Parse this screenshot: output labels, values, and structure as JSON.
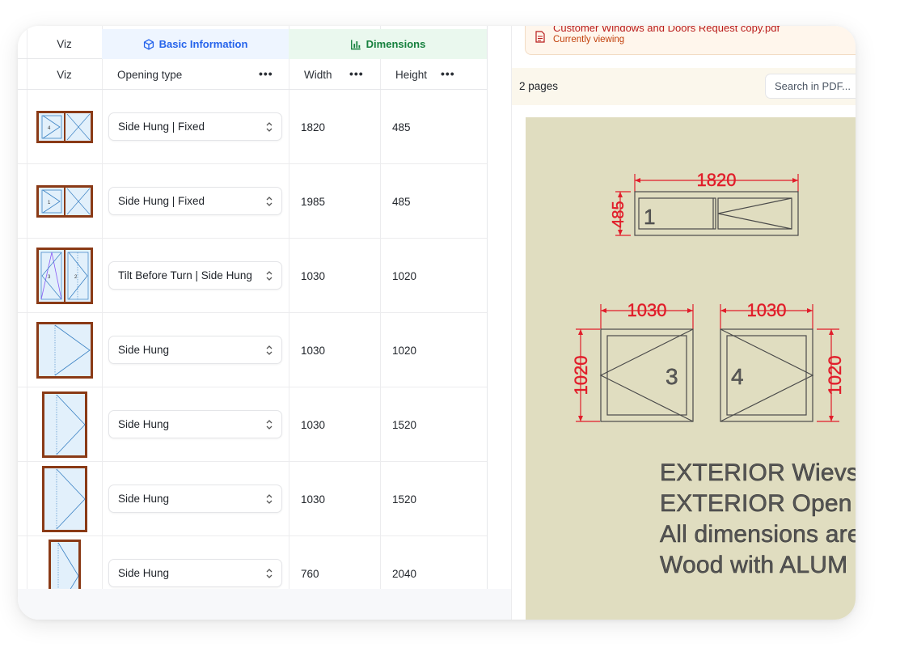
{
  "table": {
    "group_headers": {
      "viz": "Viz",
      "basic": "Basic Information",
      "dimensions": "Dimensions"
    },
    "column_headers": {
      "viz": "Viz",
      "opening_type": "Opening type",
      "width": "Width",
      "height": "Height"
    },
    "more_glyph": "•••",
    "rows": [
      {
        "opening_type": "Side Hung | Fixed",
        "width": "1820",
        "height": "485",
        "sash_labels": [
          "4"
        ]
      },
      {
        "opening_type": "Side Hung | Fixed",
        "width": "1985",
        "height": "485",
        "sash_labels": [
          "1"
        ]
      },
      {
        "opening_type": "Tilt Before Turn | Side Hung",
        "width": "1030",
        "height": "1020",
        "sash_labels": [
          "3",
          "2"
        ]
      },
      {
        "opening_type": "Side Hung",
        "width": "1030",
        "height": "1020",
        "sash_labels": []
      },
      {
        "opening_type": "Side Hung",
        "width": "1030",
        "height": "1520",
        "sash_labels": []
      },
      {
        "opening_type": "Side Hung",
        "width": "1030",
        "height": "1520",
        "sash_labels": []
      },
      {
        "opening_type": "Side Hung",
        "width": "760",
        "height": "2040",
        "sash_labels": []
      }
    ]
  },
  "pdf": {
    "file_name": "Customer Windows and Doors Request copy.pdf",
    "file_status": "Currently viewing",
    "page_count": "2 pages",
    "search_placeholder": "Search in PDF...",
    "drawing": {
      "dims_top": {
        "width": "1820",
        "height": "485",
        "label": "1"
      },
      "dims_left": {
        "width": "1030",
        "height": "1020",
        "label": "3"
      },
      "dims_right": {
        "width": "1030",
        "height": "1020",
        "label": "4"
      },
      "notes": [
        "EXTERIOR Wievs",
        "EXTERIOR Open",
        "All dimensions are",
        "Wood with ALUM"
      ]
    }
  },
  "colors": {
    "frame_brown": "#8a3a16",
    "glass": "#e2f0fb",
    "sash_blue": "#3b82c4",
    "dim_red": "#e11d2a",
    "paper": "#e0ddc0",
    "basic_accent": "#2563eb",
    "dims_accent": "#15803d"
  }
}
